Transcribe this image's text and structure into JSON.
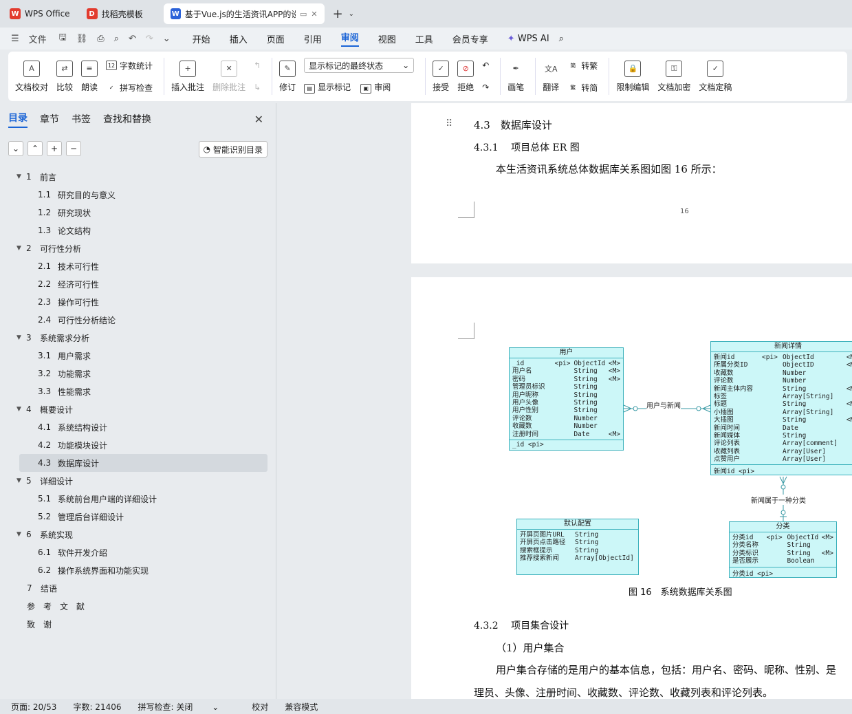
{
  "tabs": [
    {
      "label": "WPS Office",
      "color": "#e23b2e",
      "glyph": "W"
    },
    {
      "label": "找稻壳模板",
      "color": "#e23b2e",
      "glyph": "D"
    },
    {
      "label": "基于Vue.js的生活资讯APP的设",
      "color": "#2b62d9",
      "glyph": "W"
    }
  ],
  "menu": {
    "file": "文件",
    "items": [
      "开始",
      "插入",
      "页面",
      "引用",
      "审阅",
      "视图",
      "工具",
      "会员专享"
    ],
    "active": "审阅",
    "wps_ai": "WPS AI"
  },
  "ribbon": {
    "doc_check": "文档校对",
    "compare": "比较",
    "read_aloud": "朗读",
    "word_count": "字数统计",
    "spell_check": "拼写检查",
    "insert_comment": "插入批注",
    "delete_comment": "删除批注",
    "revise": "修订",
    "markup_state": "显示标记的最终状态",
    "show_markup": "显示标记",
    "review": "审阅",
    "accept": "接受",
    "reject": "拒绝",
    "pen": "画笔",
    "translate": "翻译",
    "to_traditional": "转繁",
    "to_simplified": "转简",
    "restrict_edit": "限制编辑",
    "encrypt": "文档加密",
    "finalize": "文档定稿"
  },
  "sidebar": {
    "tabs": [
      "目录",
      "章节",
      "书签",
      "查找和替换"
    ],
    "smart_toc": "智能识别目录",
    "toc": [
      {
        "level": 1,
        "num": "1",
        "title": "前言"
      },
      {
        "level": 2,
        "num": "1.1",
        "title": "研究目的与意义"
      },
      {
        "level": 2,
        "num": "1.2",
        "title": "研究现状"
      },
      {
        "level": 2,
        "num": "1.3",
        "title": "论文结构"
      },
      {
        "level": 1,
        "num": "2",
        "title": "可行性分析"
      },
      {
        "level": 2,
        "num": "2.1",
        "title": "技术可行性"
      },
      {
        "level": 2,
        "num": "2.2",
        "title": "经济可行性"
      },
      {
        "level": 2,
        "num": "2.3",
        "title": "操作可行性"
      },
      {
        "level": 2,
        "num": "2.4",
        "title": "可行性分析结论"
      },
      {
        "level": 1,
        "num": "3",
        "title": "系统需求分析"
      },
      {
        "level": 2,
        "num": "3.1",
        "title": "用户需求"
      },
      {
        "level": 2,
        "num": "3.2",
        "title": "功能需求"
      },
      {
        "level": 2,
        "num": "3.3",
        "title": "性能需求"
      },
      {
        "level": 1,
        "num": "4",
        "title": "概要设计"
      },
      {
        "level": 2,
        "num": "4.1",
        "title": "系统结构设计"
      },
      {
        "level": 2,
        "num": "4.2",
        "title": "功能模块设计"
      },
      {
        "level": 2,
        "num": "4.3",
        "title": "数据库设计",
        "selected": true
      },
      {
        "level": 1,
        "num": "5",
        "title": "详细设计"
      },
      {
        "level": 2,
        "num": "5.1",
        "title": "系统前台用户端的详细设计"
      },
      {
        "level": 2,
        "num": "5.2",
        "title": "管理后台详细设计"
      },
      {
        "level": 1,
        "num": "6",
        "title": "系统实现"
      },
      {
        "level": 2,
        "num": "6.1",
        "title": "软件开发介绍"
      },
      {
        "level": 2,
        "num": "6.2",
        "title": "操作系统界面和功能实现"
      },
      {
        "level": 0,
        "num": "7",
        "title": "结语"
      },
      {
        "level": 0,
        "num": "",
        "title": "参考文献",
        "spaced": true
      },
      {
        "level": 0,
        "num": "",
        "title": "致谢",
        "spaced": true
      }
    ]
  },
  "doc": {
    "h_43": "4.3　数据库设计",
    "h_431": "4.3.1　 项目总体 ER 图",
    "p_er": "本生活资讯系统总体数据库关系图如图 16 所示：",
    "page_num": "16",
    "caption": "图 16　系统数据库关系图",
    "h_432": "4.3.2　 项目集合设计",
    "p_user_title": "（1）用户集合",
    "p_user_1": "用户集合存储的是用户的基本信息，包括：用户名、密码、昵称、性别、是",
    "p_user_2": "理员、头像、注册时间、收藏数、评论数、收藏列表和评论列表。"
  },
  "er": {
    "user": {
      "title": "用户",
      "rows": [
        [
          "_id",
          "<pi>",
          "ObjectId",
          "<M>"
        ],
        [
          "用户名",
          "",
          "String",
          "<M>"
        ],
        [
          "密码",
          "",
          "String",
          "<M>"
        ],
        [
          "管理员标识",
          "",
          "String",
          ""
        ],
        [
          "用户昵称",
          "",
          "String",
          ""
        ],
        [
          "用户头像",
          "",
          "String",
          ""
        ],
        [
          "用户性别",
          "",
          "String",
          ""
        ],
        [
          "评论数",
          "",
          "Number",
          ""
        ],
        [
          "收藏数",
          "",
          "Number",
          ""
        ],
        [
          "注册时间",
          "",
          "Date",
          "<M>"
        ]
      ],
      "key": "_id <pi>"
    },
    "news": {
      "title": "新闻详情",
      "rows": [
        [
          "新闻id",
          "<pi>",
          "ObjectId",
          "<M>"
        ],
        [
          "所属分类ID",
          "",
          "ObjectID",
          "<M>"
        ],
        [
          "收藏数",
          "",
          "Number",
          ""
        ],
        [
          "评论数",
          "",
          "Number",
          ""
        ],
        [
          "新闻主体内容",
          "",
          "String",
          "<M>"
        ],
        [
          "标签",
          "",
          "Array[String]",
          ""
        ],
        [
          "标题",
          "",
          "String",
          "<M>"
        ],
        [
          "小插图",
          "",
          "Array[String]",
          ""
        ],
        [
          "大插图",
          "",
          "String",
          "<M>"
        ],
        [
          "新闻时间",
          "",
          "Date",
          ""
        ],
        [
          "新闻媒体",
          "",
          "String",
          ""
        ],
        [
          "评论列表",
          "",
          "Array[comment]",
          ""
        ],
        [
          "收藏列表",
          "",
          "Array[User]",
          ""
        ],
        [
          "点赞用户",
          "",
          "Array[User]",
          ""
        ]
      ],
      "key": "新闻id <pi>"
    },
    "config": {
      "title": "默认配置",
      "rows": [
        [
          "开屏页图片URL",
          "",
          "String",
          ""
        ],
        [
          "开屏页点击路径",
          "",
          "String",
          ""
        ],
        [
          "搜索框提示",
          "",
          "String",
          ""
        ],
        [
          "推荐搜索新闻",
          "",
          "Array[ObjectId]",
          ""
        ]
      ]
    },
    "category": {
      "title": "分类",
      "rows": [
        [
          "分类id",
          "<pi>",
          "ObjectId",
          "<M>"
        ],
        [
          "分类名称",
          "",
          "String",
          ""
        ],
        [
          "分类标识",
          "",
          "String",
          "<M>"
        ],
        [
          "是否展示",
          "",
          "Boolean",
          ""
        ]
      ],
      "key": "分类id <pi>"
    },
    "rel_user_news": "用户与新闻",
    "rel_news_cat": "新闻属于一种分类"
  },
  "status": {
    "page": "页面: 20/53",
    "words": "字数: 21406",
    "spell": "拼写检查: 关闭",
    "proof": "校对",
    "compat": "兼容模式"
  }
}
